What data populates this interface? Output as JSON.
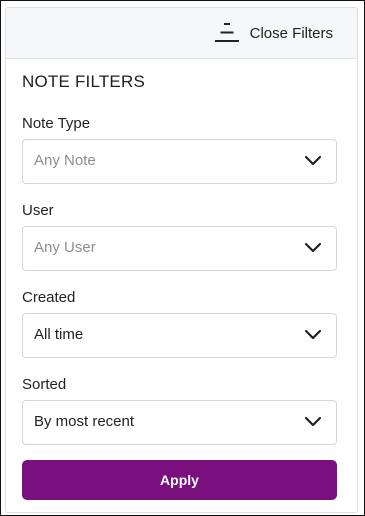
{
  "header": {
    "close_label": "Close Filters",
    "close_icon": "filter-collapse-icon"
  },
  "panel": {
    "title": "NOTE FILTERS"
  },
  "filters": [
    {
      "label": "Note Type",
      "value": "Any Note",
      "is_placeholder": true
    },
    {
      "label": "User",
      "value": "Any User",
      "is_placeholder": true
    },
    {
      "label": "Created",
      "value": "All time",
      "is_placeholder": false
    },
    {
      "label": "Sorted",
      "value": "By most recent",
      "is_placeholder": false
    }
  ],
  "apply": {
    "label": "Apply"
  },
  "colors": {
    "accent": "#7a0f7e",
    "placeholder_text": "#8a8f96",
    "header_bg": "#f6f7f9",
    "border": "#d4d7dc"
  }
}
